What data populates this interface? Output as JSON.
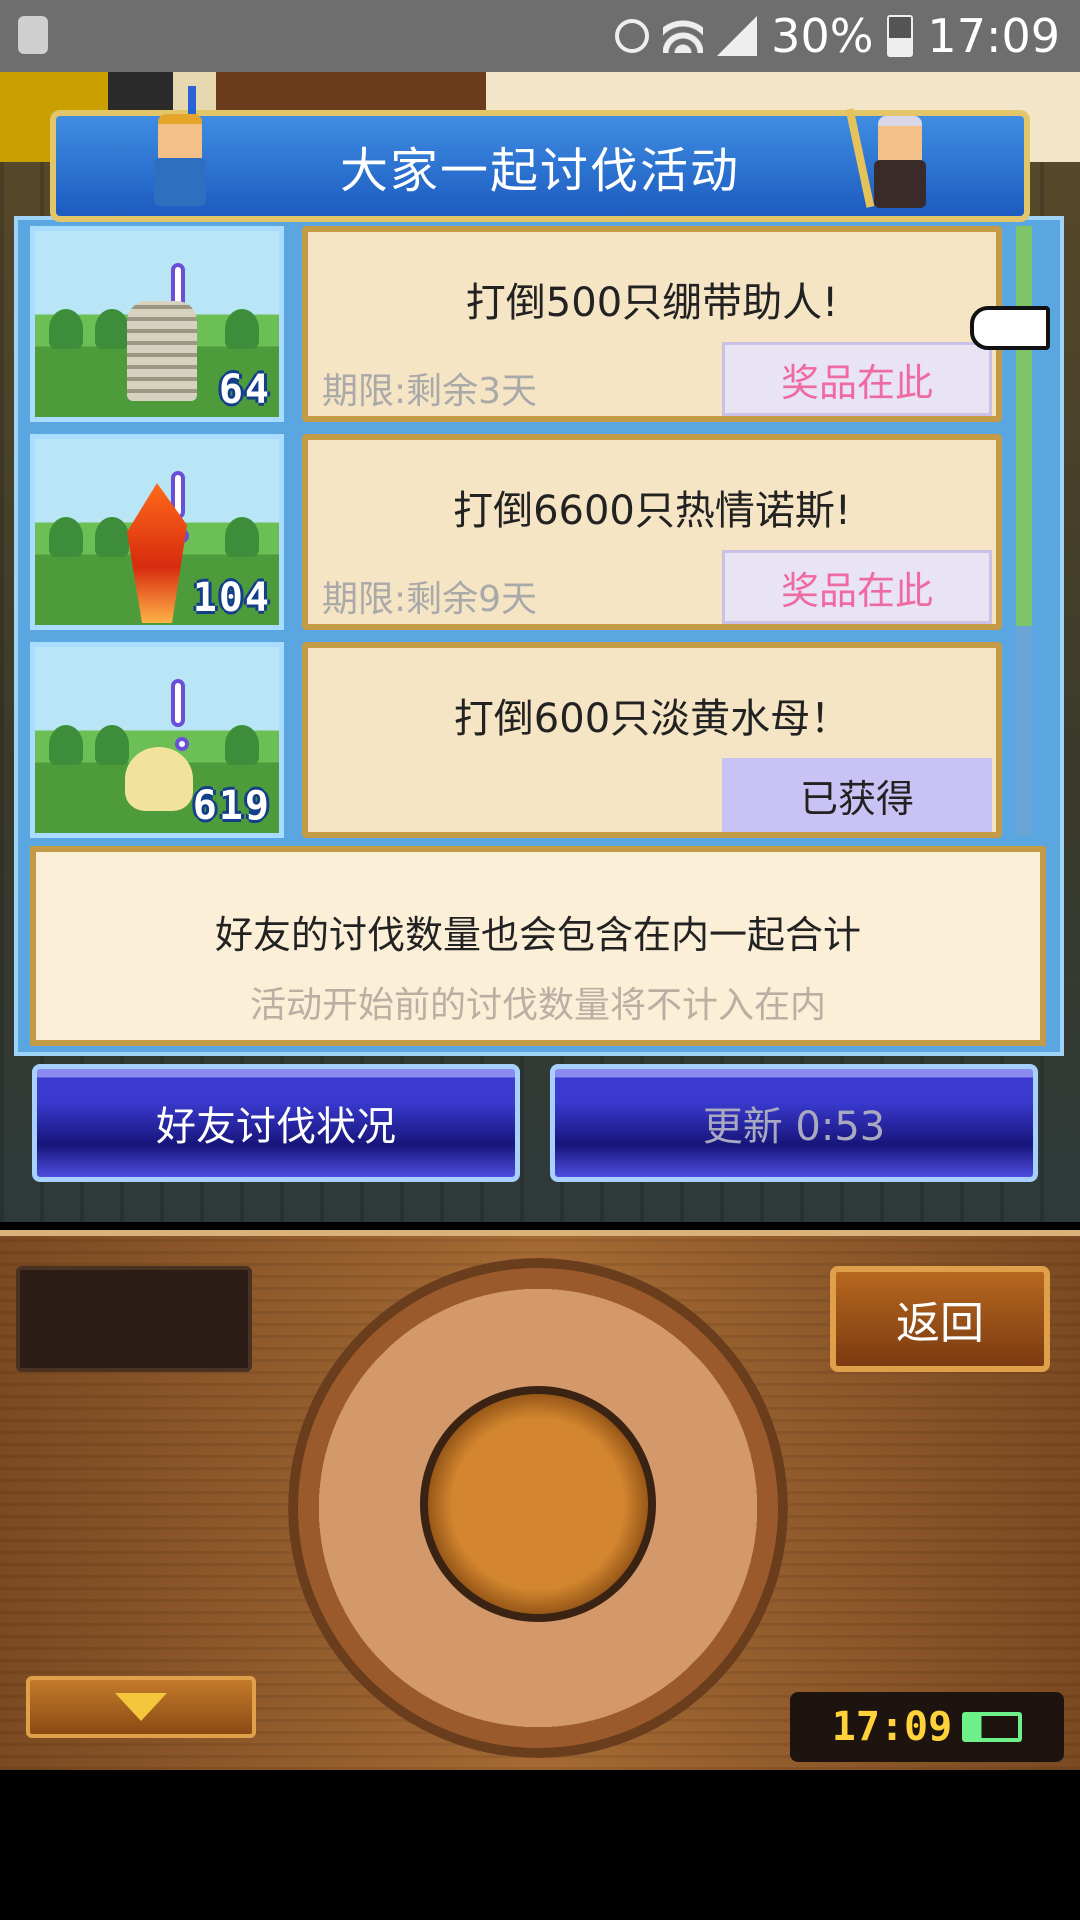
{
  "status_bar": {
    "battery_percent": "30%",
    "time": "17:09"
  },
  "header": {
    "title": "大家一起讨伐活动"
  },
  "quests": [
    {
      "count": "64",
      "title": "打倒500只绷带助人!",
      "deadline": "期限:剩余3天",
      "button": "奖品在此",
      "state": "prize"
    },
    {
      "count": "104",
      "title": "打倒6600只热情诺斯!",
      "deadline": "期限:剩余9天",
      "button": "奖品在此",
      "state": "prize"
    },
    {
      "count": "619",
      "title": "打倒600只淡黄水母！",
      "deadline": "",
      "button": "已获得",
      "state": "obtained"
    }
  ],
  "note": {
    "main": "好友的讨伐数量也会包含在内一起合计",
    "sub": "活动开始前的讨伐数量将不计入在内"
  },
  "buttons": {
    "friends_status": "好友讨伐状况",
    "update": "更新 0:53",
    "back": "返回"
  },
  "device_clock": "17:09",
  "colors": {
    "header_blue": "#2a6ed6",
    "card_bg": "#f6e5c4",
    "prize_text": "#ef6aa3",
    "obtained_bg": "#c8c3f4"
  }
}
